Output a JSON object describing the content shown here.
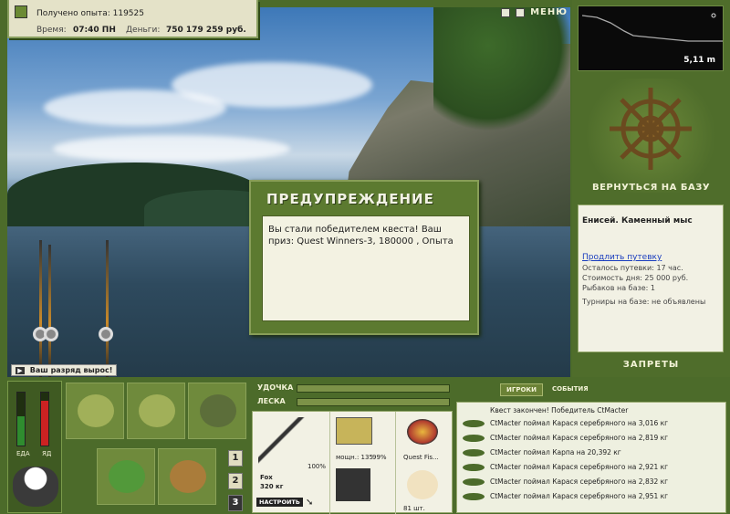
{
  "header": {
    "experience_label": "Получено опыта:",
    "experience_value": "119525",
    "time_label": "Время:",
    "time_value": "07:40 ПН",
    "money_label": "Деньги:",
    "money_value": "750 179 259 руб."
  },
  "top_controls": {
    "pause_icon": "pause-icon",
    "settings_icon": "s-icon",
    "menu_label": "МЕНЮ"
  },
  "depth": {
    "value": "5,11 m"
  },
  "base": {
    "return_label": "ВЕРНУТЬСЯ НА БАЗУ",
    "location": "Енисей. Каменный мыс",
    "extend_link": "Продлить путевку",
    "lines": [
      "Осталось путевки: 17 час.",
      "Стоимость дня: 25 000 руб.",
      "Рыбаков на базе: 1",
      "Турниры на базе: не объявлены"
    ],
    "bans_label": "ЗАПРЕТЫ"
  },
  "modal": {
    "title": "ПРЕДУПРЕЖДЕНИЕ",
    "message": "Вы стали победителем квеста! Ваш приз: Quest Winners-3, 180000 , Опыта"
  },
  "rank_notice": "Ваш разряд вырос!",
  "status_bars": {
    "food_label": "ЕДА",
    "poison_label": "ЯД"
  },
  "slot_numbers": [
    "1",
    "2",
    "3"
  ],
  "tackle": {
    "rod_label": "УДОЧКА",
    "line_label": "ЛЕСКА",
    "rod_name": "Fox",
    "rod_weight": "320 кг",
    "rod_percent": "100%",
    "reel_power": "мощн.: 135",
    "reel_percent": "99%",
    "bait_name": "Quest Fis...",
    "bait_count": "81 шт.",
    "setup_button": "НАСТРОИТЬ"
  },
  "events": {
    "tab_players": "ИГРОКИ",
    "tab_events": "СОБЫТИЯ",
    "quest_finished": "Квест закончен! Победитель CtMacter",
    "rows": [
      "CtMacter поймал Карася серебряного на 3,016 кг",
      "CtMacter поймал Карася серебряного на 2,819 кг",
      "CtMacter поймал Карпа на 20,392 кг",
      "CtMacter поймал Карася серебряного на 2,921 кг",
      "CtMacter поймал Карася серебряного на 2,832 кг",
      "CtMacter поймал Карася серебряного на 2,951 кг"
    ]
  },
  "colors": {
    "panel_green": "#4c6b2a",
    "text_light": "#f2f2d6",
    "link_blue": "#1a3dbe"
  }
}
